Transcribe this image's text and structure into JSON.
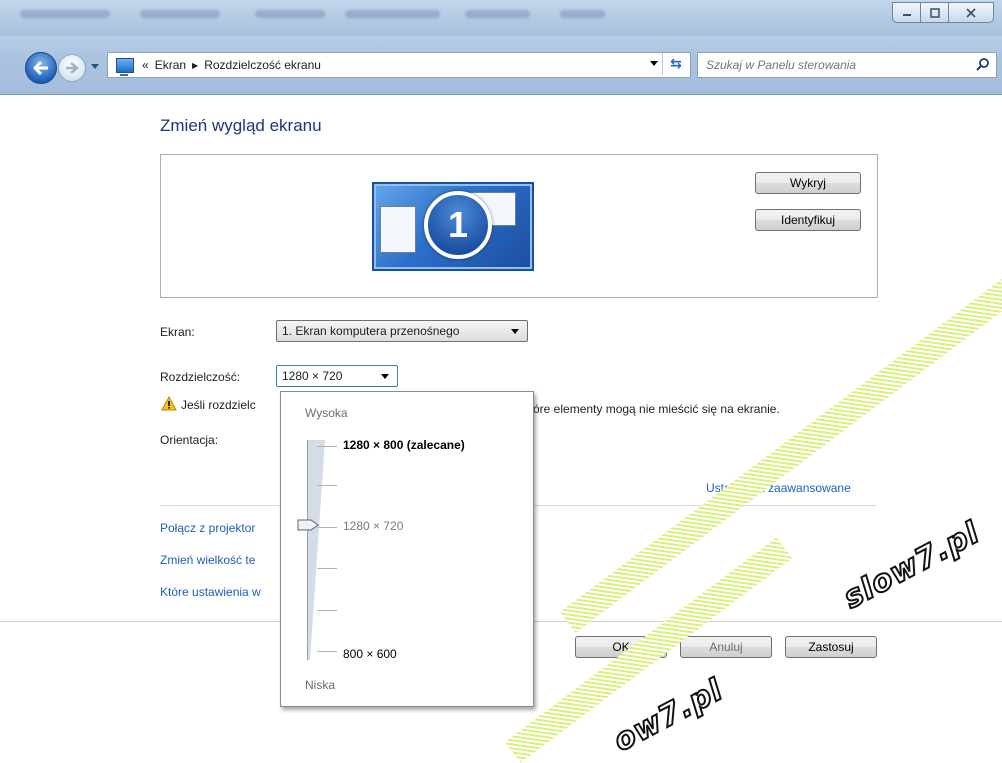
{
  "window": {
    "controls": {
      "minimize": "minimize-icon",
      "maximize": "maximize-icon",
      "close": "close-icon"
    }
  },
  "nav": {
    "breadcrumb_overflow": "«",
    "breadcrumb": [
      "Ekran",
      "Rozdzielczość ekranu"
    ],
    "search_placeholder": "Szukaj w Panelu sterowania"
  },
  "page": {
    "title": "Zmień wygląd ekranu",
    "monitor_number": "1",
    "detect_label": "Wykryj",
    "identify_label": "Identyfikuj"
  },
  "settings": {
    "display_label": "Ekran:",
    "display_value": "1. Ekran komputera przenośnego",
    "resolution_label": "Rozdzielczość:",
    "resolution_value": "1280 × 720",
    "warning_text_start": "Jeśli rozdzielc",
    "warning_text_end": "óre elementy mogą nie mieścić się na ekranie.",
    "orientation_label": "Orientacja:",
    "advanced_link": "Ustawienia zaawansowane"
  },
  "links": {
    "projector": "Połącz z projektor",
    "text_size": "Zmień wielkość te",
    "which_settings": "Które ustawienia w"
  },
  "buttons": {
    "ok": "OK",
    "cancel": "Anuluj",
    "apply": "Zastosuj"
  },
  "resolution_popup": {
    "high_label": "Wysoka",
    "low_label": "Niska",
    "top_option": "1280 × 800 (zalecane)",
    "current_option": "1280 × 720",
    "bottom_option": "800 × 600"
  },
  "watermark": {
    "text1": "slow7.pl",
    "text2": "ow7.pl",
    "text3": "slow7.pl"
  },
  "colors": {
    "link": "#1e5fba",
    "title": "#1e3287",
    "watermark_fill": "#d8f07e"
  }
}
